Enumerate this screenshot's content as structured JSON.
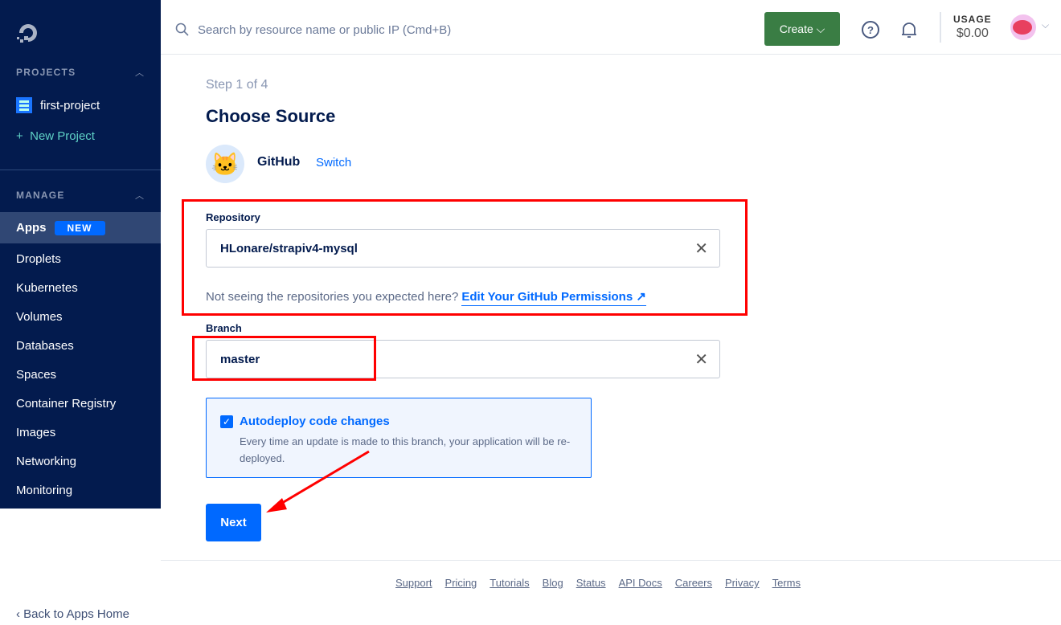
{
  "sidebar": {
    "projects_label": "PROJECTS",
    "project": "first-project",
    "new_project": "New Project",
    "manage_label": "MANAGE",
    "items": [
      {
        "label": "Apps",
        "badge": "NEW"
      },
      {
        "label": "Droplets"
      },
      {
        "label": "Kubernetes"
      },
      {
        "label": "Volumes"
      },
      {
        "label": "Databases"
      },
      {
        "label": "Spaces"
      },
      {
        "label": "Container Registry"
      },
      {
        "label": "Images"
      },
      {
        "label": "Networking"
      },
      {
        "label": "Monitoring"
      }
    ],
    "back": "Back to Apps Home"
  },
  "topbar": {
    "search_placeholder": "Search by resource name or public IP (Cmd+B)",
    "create": "Create",
    "usage_label": "USAGE",
    "usage_value": "$0.00"
  },
  "main": {
    "step": "Step 1 of 4",
    "title": "Choose Source",
    "source": "GitHub",
    "switch": "Switch",
    "repo_label": "Repository",
    "repo_value": "HLonare/strapiv4-mysql",
    "hint": "Not seeing the repositories you expected here?",
    "hint_link": "Edit Your GitHub Permissions ↗",
    "branch_label": "Branch",
    "branch_value": "master",
    "autodeploy_title": "Autodeploy code changes",
    "autodeploy_desc": "Every time an update is made to this branch, your application will be re-deployed.",
    "autodeploy_checked": true,
    "next": "Next"
  },
  "footer": [
    "Support",
    "Pricing",
    "Tutorials",
    "Blog",
    "Status",
    "API Docs",
    "Careers",
    "Privacy",
    "Terms"
  ]
}
